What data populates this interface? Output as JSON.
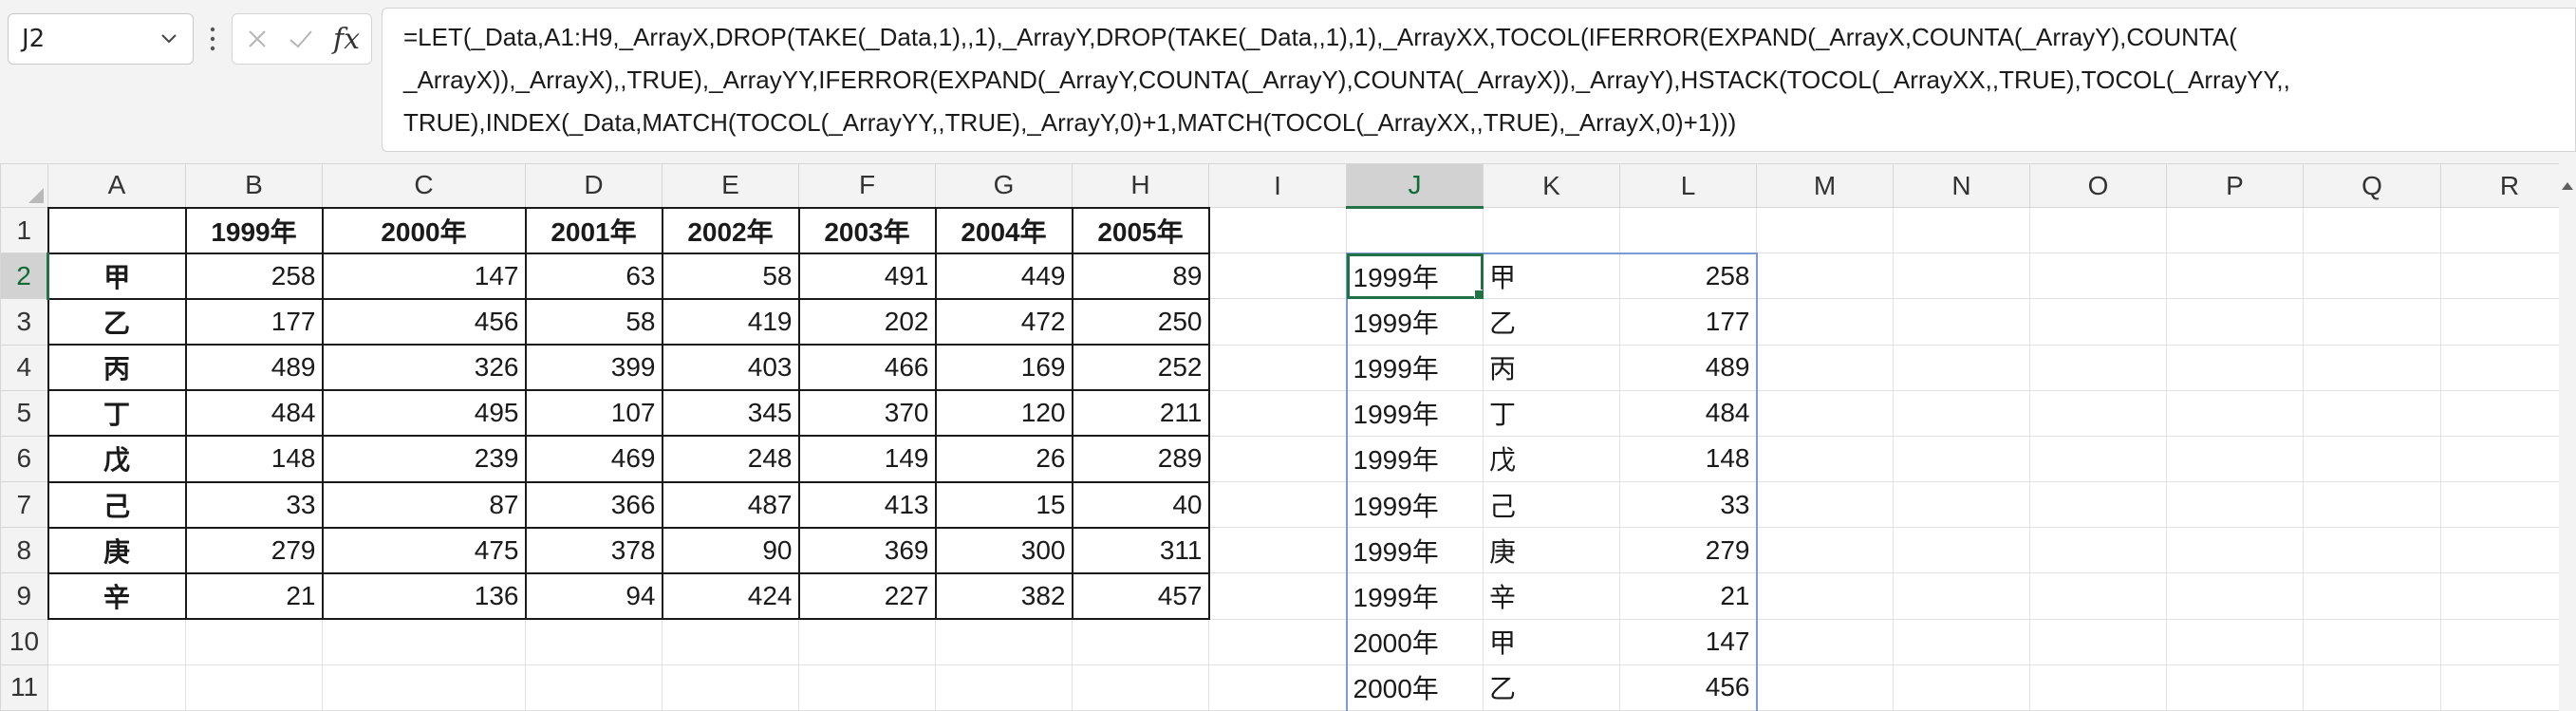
{
  "name_box": {
    "value": "J2"
  },
  "formula_bar": {
    "fx_label": "fx",
    "lines": [
      "=LET(_Data,A1:H9,_ArrayX,DROP(TAKE(_Data,1),,1),_ArrayY,DROP(TAKE(_Data,,1),1),_ArrayXX,TOCOL(IFERROR(EXPAND(_ArrayX,COUNTA(_ArrayY),COUNTA(",
      "_ArrayX)),_ArrayX),,TRUE),_ArrayYY,IFERROR(EXPAND(_ArrayY,COUNTA(_ArrayY),COUNTA(_ArrayX)),_ArrayY),HSTACK(TOCOL(_ArrayXX,,TRUE),TOCOL(_ArrayYY,,",
      "TRUE),INDEX(_Data,MATCH(TOCOL(_ArrayYY,,TRUE),_ArrayY,0)+1,MATCH(TOCOL(_ArrayXX,,TRUE),_ArrayX,0)+1)))"
    ]
  },
  "columns": [
    "A",
    "B",
    "C",
    "D",
    "E",
    "F",
    "G",
    "H",
    "I",
    "J",
    "K",
    "L",
    "M",
    "N",
    "O",
    "P",
    "Q",
    "R"
  ],
  "rows": [
    "1",
    "2",
    "3",
    "4",
    "5",
    "6",
    "7",
    "8",
    "9",
    "10",
    "11"
  ],
  "source_table": {
    "years": [
      "1999年",
      "2000年",
      "2001年",
      "2002年",
      "2003年",
      "2004年",
      "2005年"
    ],
    "rows": [
      {
        "label": "甲",
        "values": [
          "258",
          "147",
          "63",
          "58",
          "491",
          "449",
          "89"
        ]
      },
      {
        "label": "乙",
        "values": [
          "177",
          "456",
          "58",
          "419",
          "202",
          "472",
          "250"
        ]
      },
      {
        "label": "丙",
        "values": [
          "489",
          "326",
          "399",
          "403",
          "466",
          "169",
          "252"
        ]
      },
      {
        "label": "丁",
        "values": [
          "484",
          "495",
          "107",
          "345",
          "370",
          "120",
          "211"
        ]
      },
      {
        "label": "戊",
        "values": [
          "148",
          "239",
          "469",
          "248",
          "149",
          "26",
          "289"
        ]
      },
      {
        "label": "己",
        "values": [
          "33",
          "87",
          "366",
          "487",
          "413",
          "15",
          "40"
        ]
      },
      {
        "label": "庚",
        "values": [
          "279",
          "475",
          "378",
          "90",
          "369",
          "300",
          "311"
        ]
      },
      {
        "label": "辛",
        "values": [
          "21",
          "136",
          "94",
          "424",
          "227",
          "382",
          "457"
        ]
      }
    ]
  },
  "spill_result": [
    [
      "1999年",
      "甲",
      "258"
    ],
    [
      "1999年",
      "乙",
      "177"
    ],
    [
      "1999年",
      "丙",
      "489"
    ],
    [
      "1999年",
      "丁",
      "484"
    ],
    [
      "1999年",
      "戊",
      "148"
    ],
    [
      "1999年",
      "己",
      "33"
    ],
    [
      "1999年",
      "庚",
      "279"
    ],
    [
      "1999年",
      "辛",
      "21"
    ],
    [
      "2000年",
      "甲",
      "147"
    ],
    [
      "2000年",
      "乙",
      "456"
    ]
  ]
}
